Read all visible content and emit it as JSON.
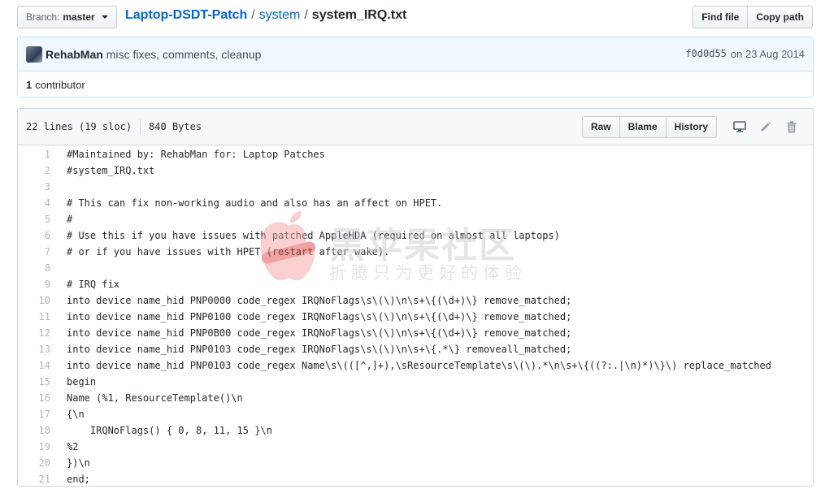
{
  "branch": {
    "label": "Branch:",
    "value": "master"
  },
  "breadcrumb": {
    "repo": "Laptop-DSDT-Patch",
    "sep1": "/",
    "dir": "system",
    "sep2": "/",
    "file": "system_IRQ.txt"
  },
  "header_buttons": {
    "find_file": "Find file",
    "copy_path": "Copy path"
  },
  "commit": {
    "author": "RehabMan",
    "message": "misc fixes, comments, cleanup",
    "sha": "f0d0d55",
    "date": "on 23 Aug 2014",
    "contributors_count": "1",
    "contributors_label": "contributor"
  },
  "file": {
    "lines_info": "22 lines (19 sloc)",
    "size": "840 Bytes",
    "buttons": {
      "raw": "Raw",
      "blame": "Blame",
      "history": "History"
    },
    "icons": [
      "desktop-icon",
      "pencil-icon",
      "trash-icon"
    ],
    "lines": [
      "#Maintained by: RehabMan for: Laptop Patches",
      "#system_IRQ.txt",
      "",
      "# This can fix non-working audio and also has an affect on HPET.",
      "#",
      "# Use this if you have issues with patched AppleHDA (required on almost all laptops)",
      "# or if you have issues with HPET (restart after wake).",
      "",
      "# IRQ fix",
      "into device name_hid PNP0000 code_regex IRQNoFlags\\s\\(\\)\\n\\s+\\{(\\d+)\\} remove_matched;",
      "into device name_hid PNP0100 code_regex IRQNoFlags\\s\\(\\)\\n\\s+\\{(\\d+)\\} remove_matched;",
      "into device name_hid PNP0B00 code_regex IRQNoFlags\\s\\(\\)\\n\\s+\\{(\\d+)\\} remove_matched;",
      "into device name_hid PNP0103 code_regex IRQNoFlags\\s\\(\\)\\n\\s+\\{.*\\} removeall_matched;",
      "into device name_hid PNP0103 code_regex Name\\s\\(([^,]+),\\sResourceTemplate\\s\\(\\).*\\n\\s+\\{((?:.|\\n)*)\\}\\) replace_matched",
      "begin",
      "Name (%1, ResourceTemplate()\\n",
      "{\\n",
      "    IRQNoFlags() { 0, 8, 11, 15 }\\n",
      "%2",
      "})\\n",
      "end;"
    ]
  },
  "watermark": {
    "title": "黑苹果社区",
    "subtitle": "折腾只为更好的体验",
    "logo_text": "macOS"
  },
  "colors": {
    "link": "#0366d6",
    "commit_bg": "#f1f8ff",
    "commit_border": "#c8e1ff",
    "line_number": "#b1b5ba"
  }
}
